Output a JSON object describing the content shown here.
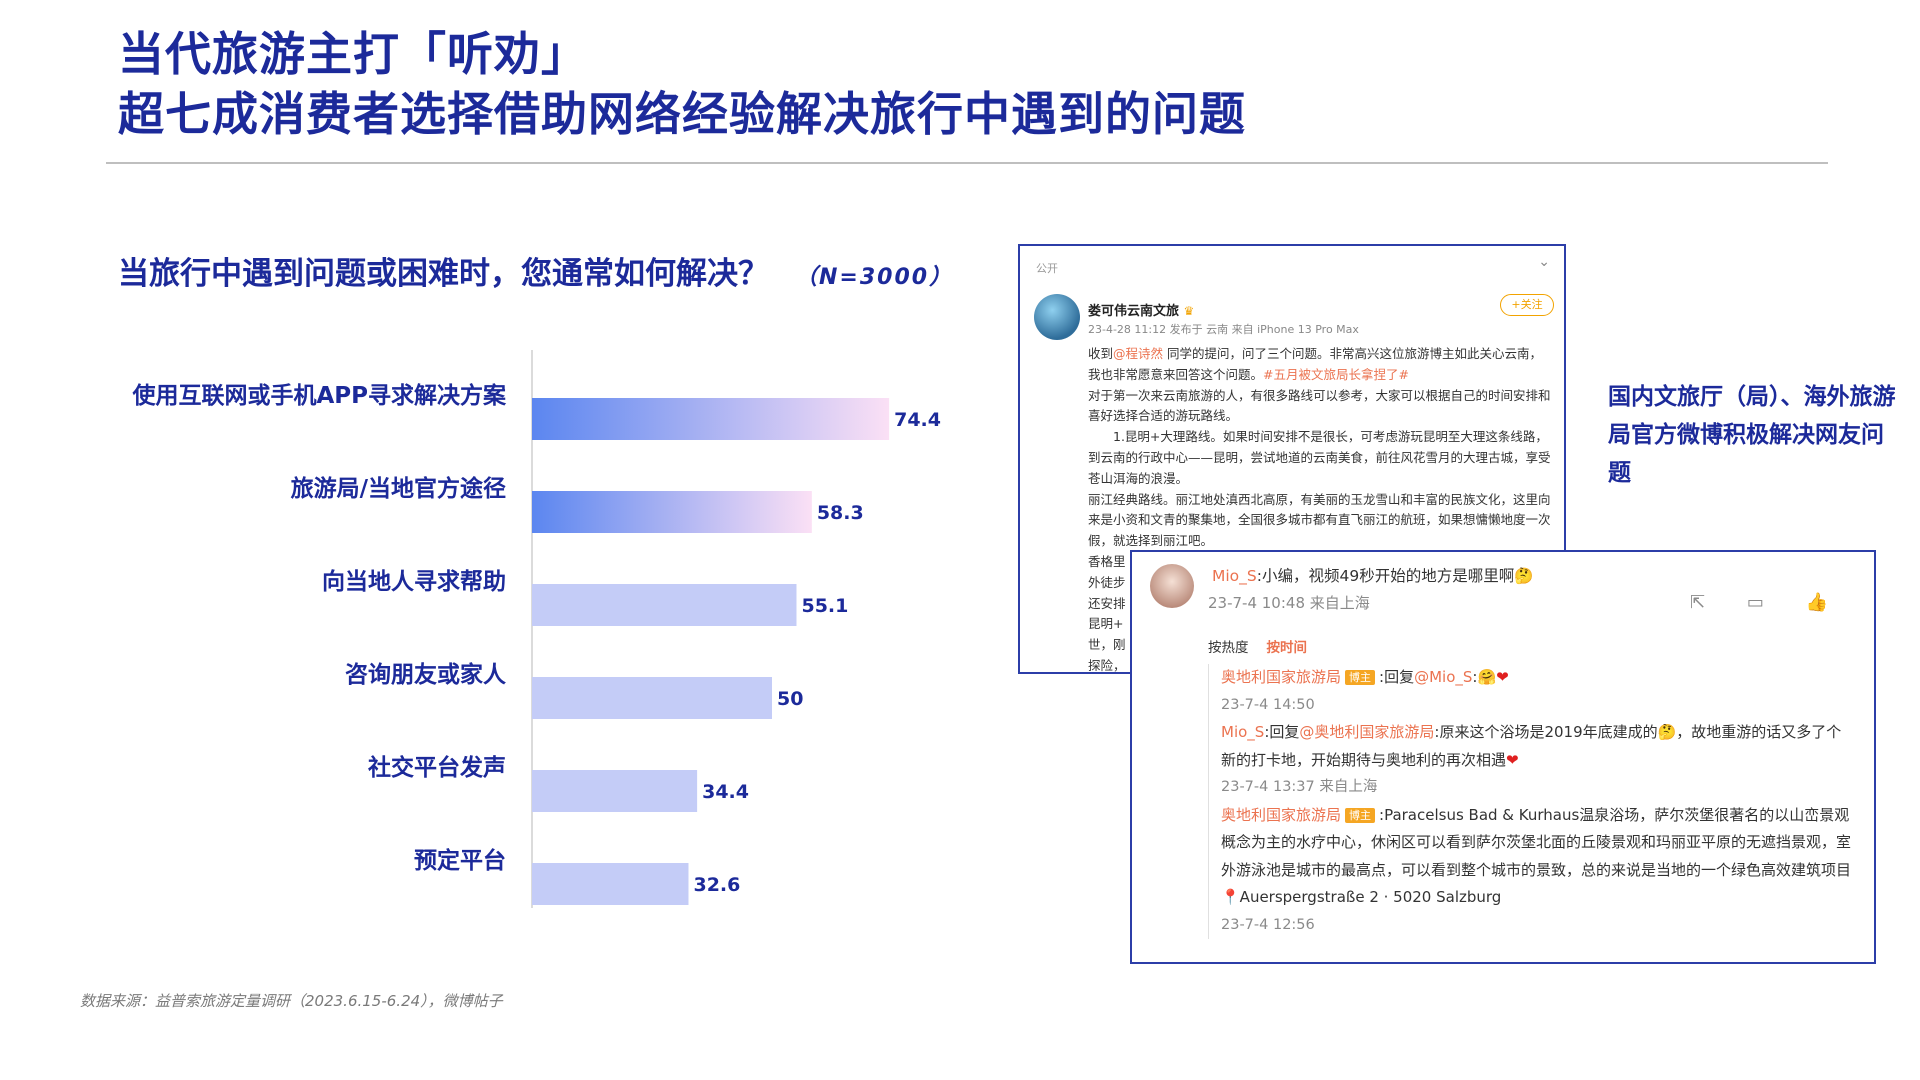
{
  "header": {
    "line1": "当代旅游主打「听劝」",
    "line2": "超七成消费者选择借助网络经验解决旅行中遇到的问题"
  },
  "survey": {
    "question": "当旅行中遇到问题或困难时，您通常如何解决？",
    "sample": "（N=3000）"
  },
  "chart_data": {
    "type": "bar",
    "orientation": "horizontal",
    "categories": [
      "使用互联网或手机APP寻求解决方案",
      "旅游局/当地官方途径",
      "向当地人寻求帮助",
      "咨询朋友或家人",
      "社交平台发声",
      "预定平台"
    ],
    "values": [
      74.4,
      58.3,
      55.1,
      50,
      34.4,
      32.6
    ],
    "value_labels": [
      "74.4",
      "58.3",
      "55.1",
      "50",
      "34.4",
      "32.6"
    ],
    "xlim": [
      0,
      100
    ],
    "grid": false,
    "colors": {
      "gradient_start": "#5b86f0",
      "gradient_end": "#fbe0f5",
      "solid": "#c4ccf7"
    }
  },
  "source": "数据来源：益普索旅游定量调研（2023.6.15-6.24），微博帖子",
  "side_note": "国内文旅厅（局）、海外旅游局官方微博积极解决网友问题",
  "post": {
    "visibility": "公开",
    "author": "娄可伟云南文旅",
    "meta": "23-4-28 11:12  发布于 云南  来自 iPhone 13 Pro Max",
    "follow": "+关注",
    "p1a": "收到",
    "p1mention": "@程诗然",
    "p1b": " 同学的提问，问了三个问题。非常高兴这位旅游博主如此关心云南，我也非常愿意来回答这个问题。",
    "p1tag": "#五月被文旅局长拿捏了#",
    "p2": "对于第一次来云南旅游的人，有很多路线可以参考，大家可以根据自己的时间安排和喜好选择合适的游玩路线。",
    "p3": "1.昆明+大理路线。如果时间安排不是很长，可考虑游玩昆明至大理这条线路，到云南的行政中心——昆明，尝试地道的云南美食，前往风花雪月的大理古城，享受苍山洱海的浪漫。",
    "p4": "丽江经典路线。丽江地处滇西北高原，有美丽的玉龙雪山和丰富的民族文化，这里向来是小资和文青的聚集地，全国很多城市都有直飞丽江的航班，如果想慵懒地度一次假，就选择到丽江吧。",
    "p5": "香格里",
    "p6": "外徒步",
    "p7": "还安排",
    "p8": "昆明+",
    "p9": "世，刚",
    "p10": "探险，"
  },
  "comment": {
    "user": "Mio_S",
    "text": ":小编，视频49秒开始的地方是哪里啊🤔",
    "time": "23-7-4 10:48 来自上海",
    "icons": "⇱ ▭ 👍",
    "sort_hot": "按热度",
    "sort_time": "按时间",
    "replies": [
      {
        "user": "奥地利国家旅游局",
        "tag": "博主",
        "pre": ":回复",
        "mention": "@Mio_S",
        "text": ":🤗",
        "emoji": "❤",
        "time": "23-7-4 14:50"
      },
      {
        "user": "Mio_S",
        "pre": ":回复",
        "mention": "@奥地利国家旅游局",
        "text": ":原来这个浴场是2019年底建成的🤔，故地重游的话又多了个新的打卡地，开始期待与奥地利的再次相遇",
        "emoji": "❤",
        "time": "23-7-4 13:37 来自上海"
      },
      {
        "user": "奥地利国家旅游局",
        "tag": "博主",
        "text": ":Paracelsus Bad & Kurhaus温泉浴场，萨尔茨堡很著名的以山峦景观概念为主的水疗中心，休闲区可以看到萨尔茨堡北面的丘陵景观和玛丽亚平原的无遮挡景观，室外游泳池是城市的最高点，可以看到整个城市的景致，总的来说是当地的一个绿色高效建筑项目📍Auerspergstraße 2 · 5020 Salzburg",
        "time": "23-7-4 12:56"
      }
    ]
  }
}
